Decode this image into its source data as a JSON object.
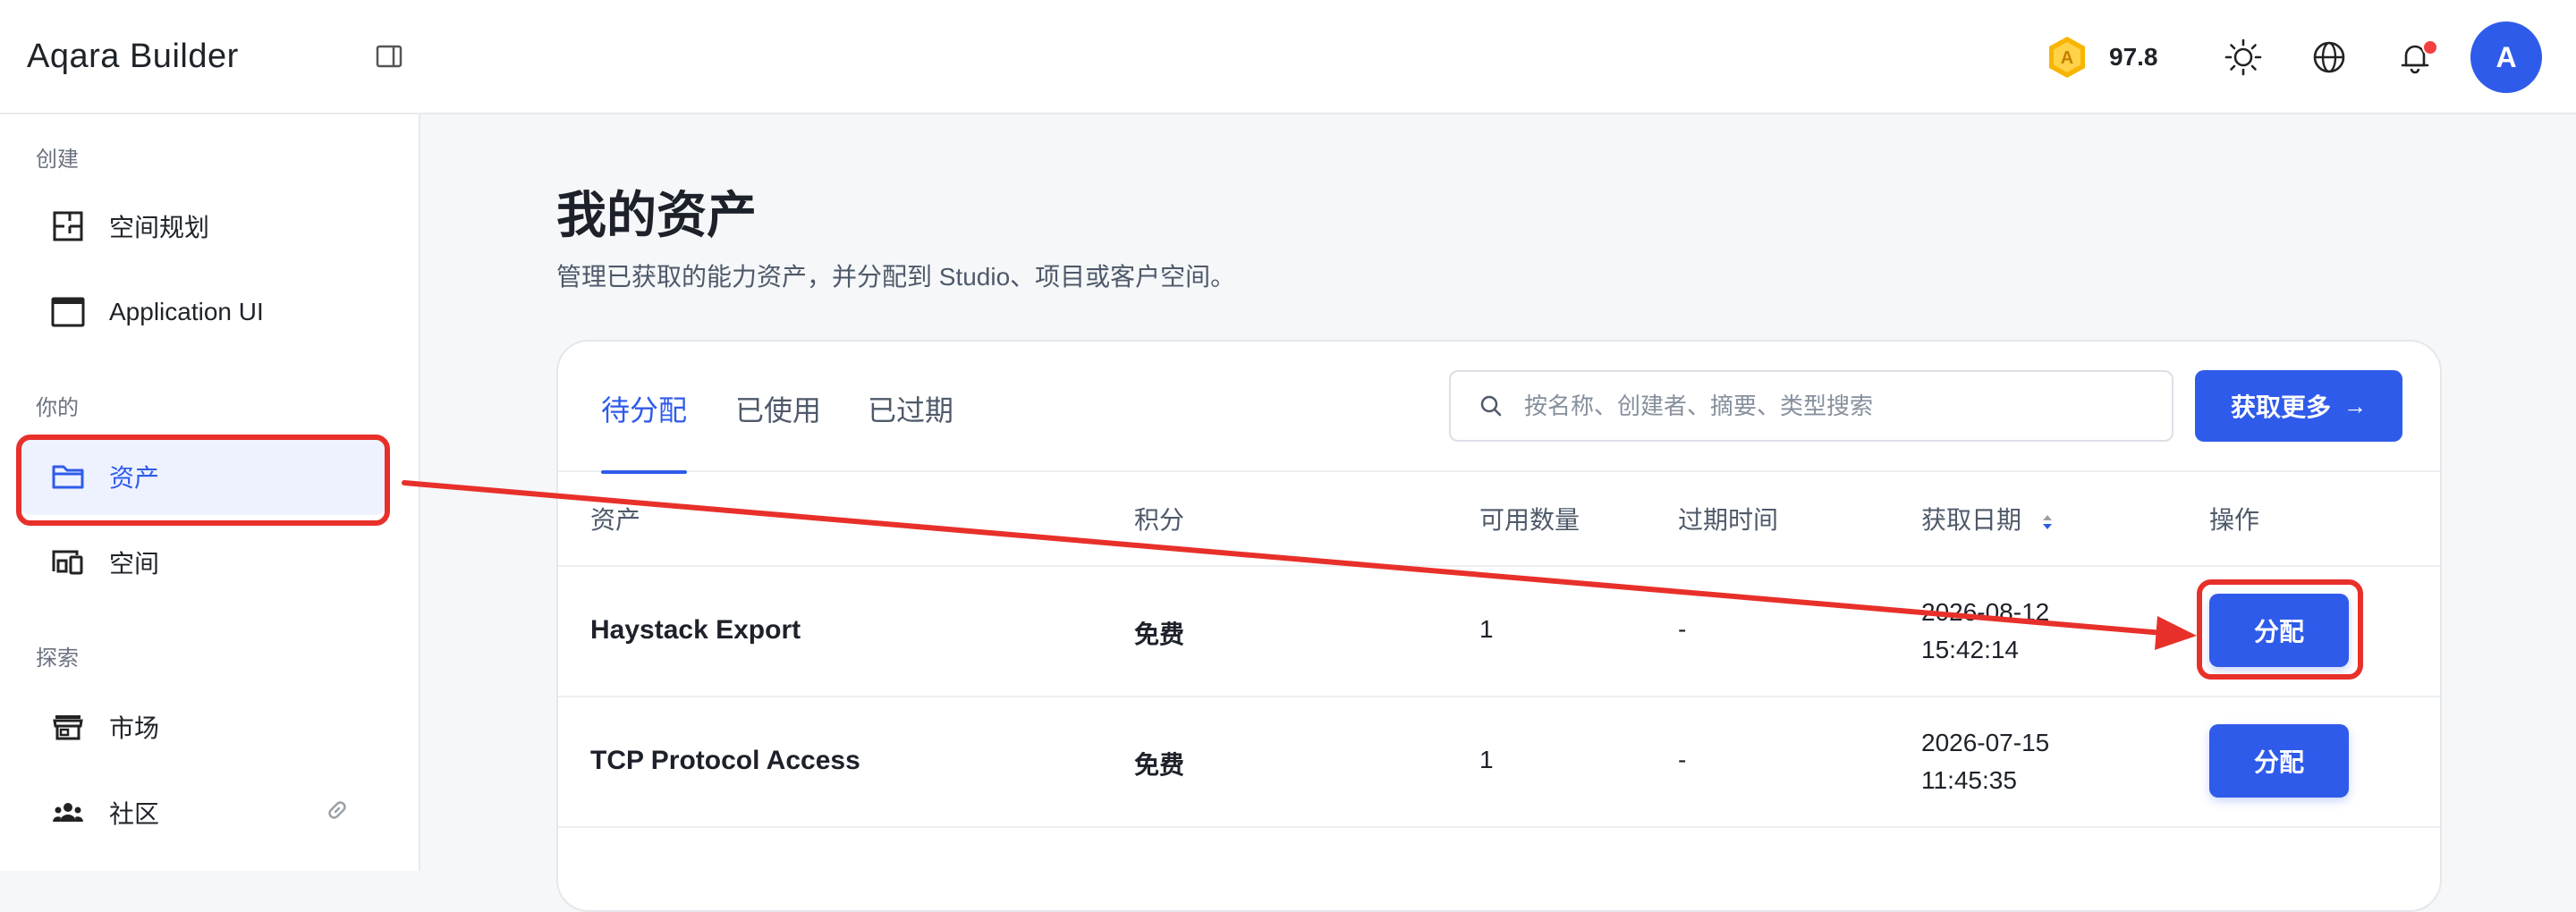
{
  "header": {
    "logo_text": "Aqara Builder",
    "points_value": "97.8",
    "avatar_letter": "A",
    "accent_color": "#2f5bea",
    "icons": [
      "sidebar-toggle-icon",
      "coin-icon",
      "theme-sun-icon",
      "globe-icon",
      "bell-icon"
    ]
  },
  "sidebar": {
    "sections": [
      {
        "label": "创建",
        "items": [
          {
            "label": "空间规划",
            "icon": "floorplan-icon"
          },
          {
            "label": "Application UI",
            "icon": "window-icon"
          }
        ]
      },
      {
        "label": "你的",
        "items": [
          {
            "label": "资产",
            "icon": "folder-icon",
            "active": true
          },
          {
            "label": "空间",
            "icon": "devices-icon"
          }
        ]
      },
      {
        "label": "探索",
        "items": [
          {
            "label": "市场",
            "icon": "store-icon"
          },
          {
            "label": "社区",
            "icon": "community-icon",
            "external_link_icon": "link-icon"
          }
        ]
      }
    ]
  },
  "main": {
    "title": "我的资产",
    "subtitle": "管理已获取的能力资产，并分配到 Studio、项目或客户空间。",
    "tabs": [
      {
        "label": "待分配",
        "active": true
      },
      {
        "label": "已使用"
      },
      {
        "label": "已过期"
      }
    ],
    "search": {
      "placeholder": "按名称、创建者、摘要、类型搜索",
      "value": ""
    },
    "get_more_label": "获取更多",
    "table": {
      "columns": [
        "资产",
        "积分",
        "可用数量",
        "过期时间",
        "获取日期",
        "操作"
      ],
      "rows": [
        {
          "name": "Haystack Export",
          "points": "免费",
          "quantity": "1",
          "expiry": "-",
          "date": "2026-08-12",
          "time": "15:42:14",
          "action": "分配"
        },
        {
          "name": "TCP Protocol Access",
          "points": "免费",
          "quantity": "1",
          "expiry": "-",
          "date": "2026-07-15",
          "time": "11:45:35",
          "action": "分配"
        }
      ]
    }
  },
  "annotation": {
    "color": "#e8302a",
    "shapes": [
      "highlight-box-around-assets-nav",
      "arrow",
      "highlight-box-around-first-assign-button"
    ]
  }
}
